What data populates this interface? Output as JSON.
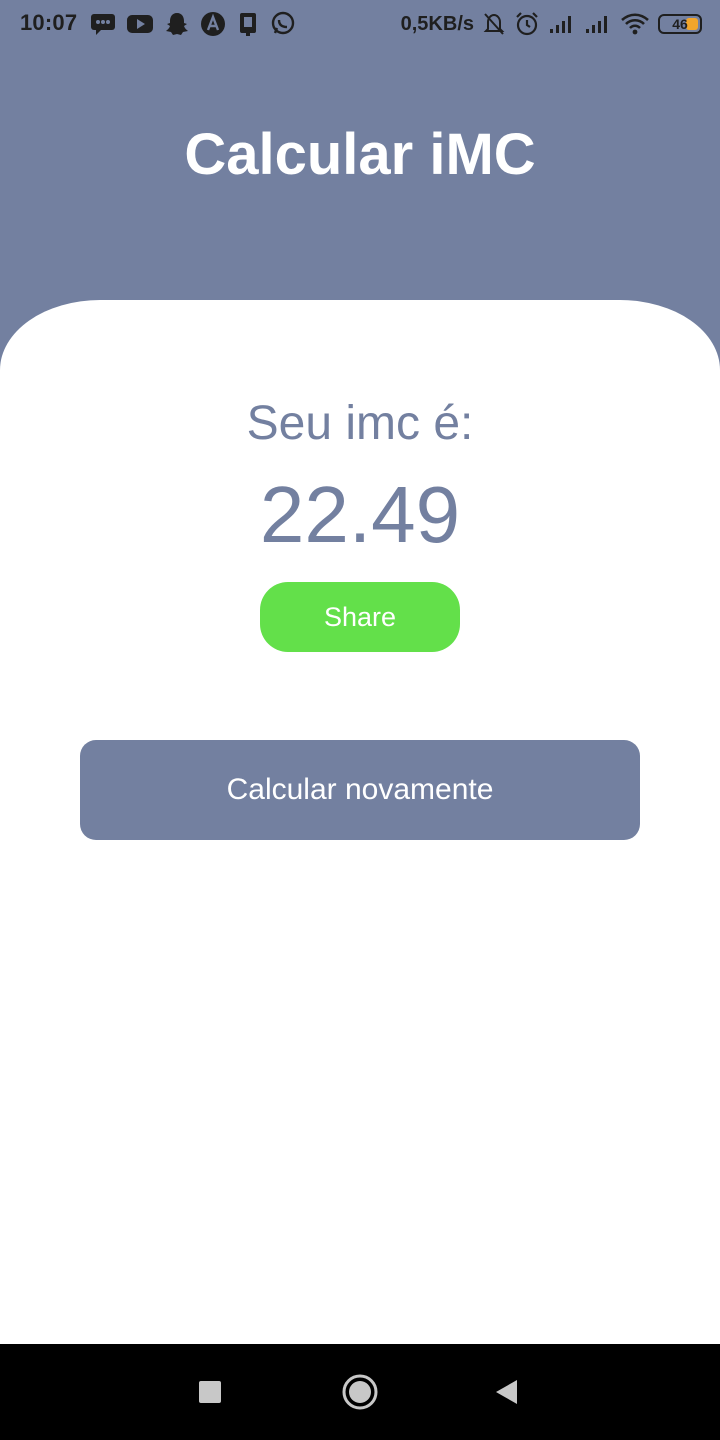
{
  "status_bar": {
    "time": "10:07",
    "net_speed": "0,5KB/s",
    "battery": "46",
    "left_icons": [
      "messages-icon",
      "youtube-icon",
      "snapchat-icon",
      "app-icon",
      "sim-icon",
      "whatsapp-icon"
    ],
    "right_icons": [
      "bell-muted-icon",
      "alarm-icon",
      "signal-icon",
      "signal-icon",
      "wifi-icon",
      "battery-icon"
    ]
  },
  "header": {
    "title": "Calcular iMC"
  },
  "result": {
    "label": "Seu imc é:",
    "value": "22.49"
  },
  "buttons": {
    "share": "Share",
    "again": "Calcular novamente"
  },
  "nav": {
    "items": [
      "recents-icon",
      "home-icon",
      "back-icon"
    ]
  },
  "colors": {
    "primary": "#7380a0",
    "share": "#63e04a",
    "surface": "#ffffff",
    "nav": "#000000",
    "battery": "#f2a52b"
  }
}
